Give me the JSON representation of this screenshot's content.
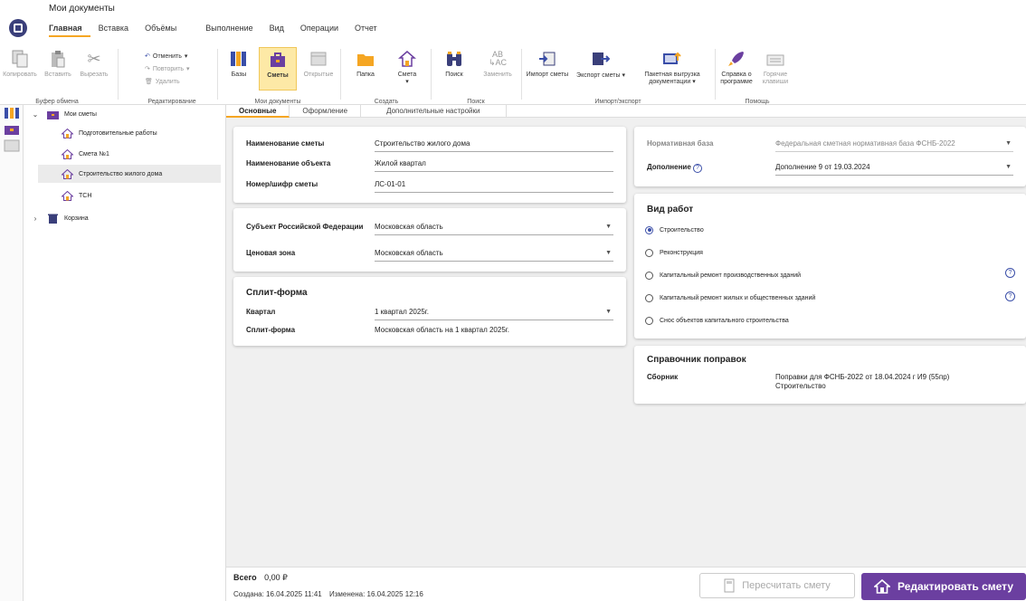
{
  "app": {
    "title": "Мои документы"
  },
  "menu_tabs": [
    "Главная",
    "Вставка",
    "Объёмы",
    "Выполнение",
    "Вид",
    "Операции",
    "Отчет"
  ],
  "ribbon": {
    "clipboard": {
      "copy": "Копировать",
      "paste": "Вставить",
      "cut": "Вырезать",
      "caption": "Буфер обмена"
    },
    "edit": {
      "undo": "Отменить",
      "redo": "Повторить",
      "delete": "Удалить",
      "caption": "Редактирование"
    },
    "docs": {
      "bases": "Базы",
      "estimates": "Сметы",
      "opened": "Открытые",
      "caption": "Мои документы"
    },
    "create": {
      "folder": "Папка",
      "estimate": "Смета",
      "caption": "Создать"
    },
    "search": {
      "search": "Поиск",
      "replace": "Заменить",
      "caption": "Поиск"
    },
    "io": {
      "import": "Импорт сметы",
      "export": "Экспорт сметы",
      "batch": "Пакетная выгрузка документации",
      "caption": "Импорт/экспорт"
    },
    "help": {
      "about": "Справка о программе",
      "hotkeys": "Горячие клавиши",
      "caption": "Помощь"
    }
  },
  "tree": {
    "root": "Мои сметы",
    "items": [
      "Подготовительные работы",
      "Смета №1",
      "Строительство жилого дома",
      "ТСН"
    ],
    "trash": "Корзина"
  },
  "content_tabs": [
    "Основные",
    "Оформление",
    "Дополнительные настройки"
  ],
  "card1": {
    "rows": [
      {
        "label": "Наименование сметы",
        "value": "Строительство жилого дома"
      },
      {
        "label": "Наименование объекта",
        "value": "Жилой квартал"
      },
      {
        "label": "Номер/шифр сметы",
        "value": "ЛС-01-01"
      }
    ]
  },
  "card2": {
    "rows": [
      {
        "label": "Субъект Российской Федерации",
        "value": "Московская область"
      },
      {
        "label": "Ценовая зона",
        "value": "Московская область"
      }
    ]
  },
  "card3": {
    "title": "Сплит-форма",
    "rows": [
      {
        "label": "Квартал",
        "value": "1 квартал 2025г."
      },
      {
        "label": "Сплит-форма",
        "value": "Московская область на 1 квартал 2025г."
      }
    ]
  },
  "card4": {
    "rows": [
      {
        "label": "Нормативная база",
        "value": "Федеральная сметная нормативная база ФСНБ-2022"
      },
      {
        "label": "Дополнение",
        "value": "Дополнение 9 от 19.03.2024"
      }
    ]
  },
  "card5": {
    "title": "Вид работ",
    "options": [
      "Строительство",
      "Реконструкция",
      "Капитальный ремонт производственных зданий",
      "Капитальный ремонт жилых и общественных зданий",
      "Снос объектов капитального строительства"
    ],
    "selected": 0
  },
  "card6": {
    "title": "Справочник поправок",
    "label": "Сборник",
    "value_line1": "Поправки для ФСНБ-2022 от 18.04.2024 г И9 (55пр)",
    "value_line2": "Строительство"
  },
  "footer": {
    "total_label": "Всего",
    "total_value": "0,00 ₽",
    "created": "Создана: 16.04.2025 11:41",
    "modified": "Изменена: 16.04.2025 12:16",
    "recalc": "Пересчитать смету",
    "edit": "Редактировать смету"
  },
  "colors": {
    "accent": "#f5a623",
    "primary": "#6b3fa0",
    "logo": "#3a3f7a"
  }
}
